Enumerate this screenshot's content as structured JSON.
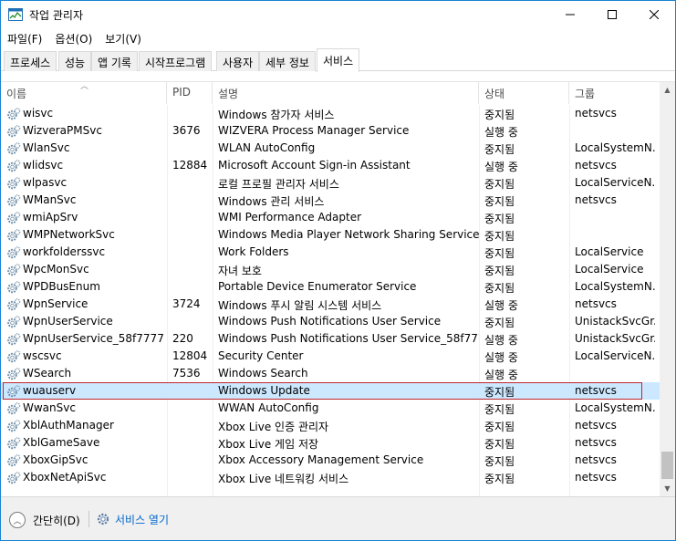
{
  "window": {
    "title": "작업 관리자"
  },
  "menu": [
    {
      "label": "파일(F)"
    },
    {
      "label": "옵션(O)"
    },
    {
      "label": "보기(V)"
    }
  ],
  "tabs": [
    {
      "label": "프로세스"
    },
    {
      "label": "성능"
    },
    {
      "label": "앱 기록"
    },
    {
      "label": "시작프로그램"
    },
    {
      "label": "사용자"
    },
    {
      "label": "세부 정보"
    },
    {
      "label": "서비스"
    }
  ],
  "active_tab": "서비스",
  "columns": {
    "name": "이름",
    "pid": "PID",
    "desc": "설명",
    "status": "상태",
    "group": "그룹"
  },
  "rows": [
    {
      "name": "wisvc",
      "pid": "",
      "desc": "Windows 참가자 서비스",
      "status": "중지됨",
      "group": "netsvcs"
    },
    {
      "name": "WizveraPMSvc",
      "pid": "3676",
      "desc": "WIZVERA Process Manager Service",
      "status": "실행 중",
      "group": ""
    },
    {
      "name": "WlanSvc",
      "pid": "",
      "desc": "WLAN AutoConfig",
      "status": "중지됨",
      "group": "LocalSystemN..."
    },
    {
      "name": "wlidsvc",
      "pid": "12884",
      "desc": "Microsoft Account Sign-in Assistant",
      "status": "실행 중",
      "group": "netsvcs"
    },
    {
      "name": "wlpasvc",
      "pid": "",
      "desc": "로컬 프로필 관리자 서비스",
      "status": "중지됨",
      "group": "LocalServiceN..."
    },
    {
      "name": "WManSvc",
      "pid": "",
      "desc": "Windows 관리 서비스",
      "status": "중지됨",
      "group": "netsvcs"
    },
    {
      "name": "wmiApSrv",
      "pid": "",
      "desc": "WMI Performance Adapter",
      "status": "중지됨",
      "group": ""
    },
    {
      "name": "WMPNetworkSvc",
      "pid": "",
      "desc": "Windows Media Player Network Sharing Service",
      "status": "중지됨",
      "group": ""
    },
    {
      "name": "workfolderssvc",
      "pid": "",
      "desc": "Work Folders",
      "status": "중지됨",
      "group": "LocalService"
    },
    {
      "name": "WpcMonSvc",
      "pid": "",
      "desc": "자녀 보호",
      "status": "중지됨",
      "group": "LocalService"
    },
    {
      "name": "WPDBusEnum",
      "pid": "",
      "desc": "Portable Device Enumerator Service",
      "status": "중지됨",
      "group": "LocalSystemN..."
    },
    {
      "name": "WpnService",
      "pid": "3724",
      "desc": "Windows 푸시 알림 시스템 서비스",
      "status": "실행 중",
      "group": "netsvcs"
    },
    {
      "name": "WpnUserService",
      "pid": "",
      "desc": "Windows Push Notifications User Service",
      "status": "중지됨",
      "group": "UnistackSvcGr..."
    },
    {
      "name": "WpnUserService_58f7777",
      "pid": "220",
      "desc": "Windows Push Notifications User Service_58f7777",
      "status": "실행 중",
      "group": "UnistackSvcGr..."
    },
    {
      "name": "wscsvc",
      "pid": "12804",
      "desc": "Security Center",
      "status": "실행 중",
      "group": "LocalServiceN..."
    },
    {
      "name": "WSearch",
      "pid": "7536",
      "desc": "Windows Search",
      "status": "실행 중",
      "group": ""
    },
    {
      "name": "wuauserv",
      "pid": "",
      "desc": "Windows Update",
      "status": "중지됨",
      "group": "netsvcs",
      "selected": true
    },
    {
      "name": "WwanSvc",
      "pid": "",
      "desc": "WWAN AutoConfig",
      "status": "중지됨",
      "group": "LocalSystemN..."
    },
    {
      "name": "XblAuthManager",
      "pid": "",
      "desc": "Xbox Live 인증 관리자",
      "status": "중지됨",
      "group": "netsvcs"
    },
    {
      "name": "XblGameSave",
      "pid": "",
      "desc": "Xbox Live 게임 저장",
      "status": "중지됨",
      "group": "netsvcs"
    },
    {
      "name": "XboxGipSvc",
      "pid": "",
      "desc": "Xbox Accessory Management Service",
      "status": "중지됨",
      "group": "netsvcs"
    },
    {
      "name": "XboxNetApiSvc",
      "pid": "",
      "desc": "Xbox Live 네트워킹 서비스",
      "status": "중지됨",
      "group": "netsvcs"
    }
  ],
  "footer": {
    "fewer_details": "간단히(D)",
    "open_services": "서비스 열기"
  },
  "colors": {
    "selection": "#cce8ff",
    "selection_border": "#c1272d",
    "link": "#0066cc"
  }
}
